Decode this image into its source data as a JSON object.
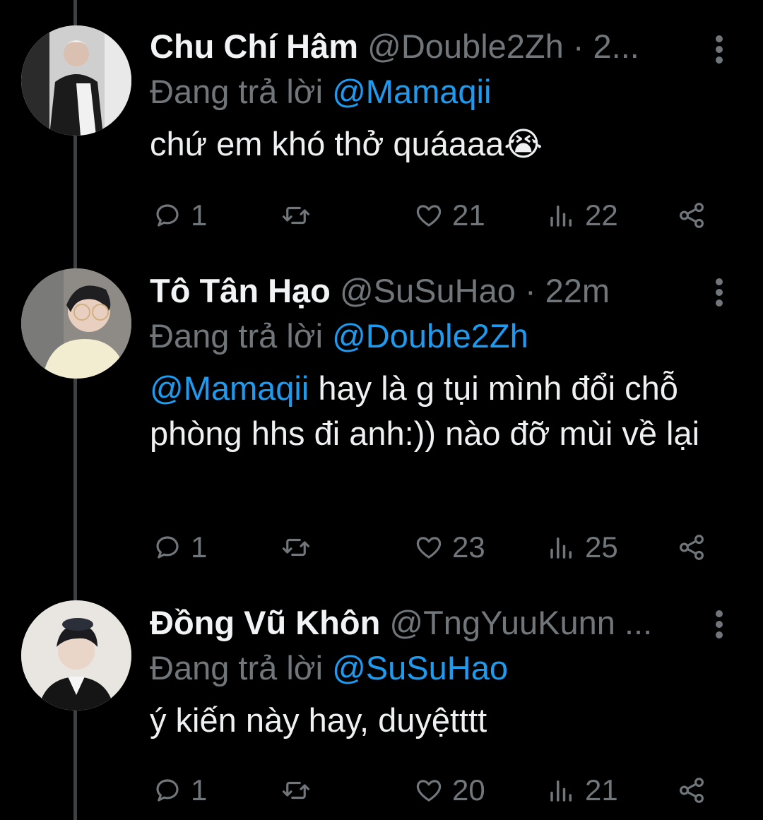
{
  "tweets": [
    {
      "name": "Chu Chí Hâm",
      "handle": "@Double2Zh",
      "time": "· 2...",
      "reply_prefix": "Đang trả lời",
      "reply_to": "@Mamaqii",
      "body_mention": "",
      "body": "chứ em khó thở quáaaa😭",
      "replies": "1",
      "retweets": "",
      "likes": "21",
      "views": "22"
    },
    {
      "name": "Tô Tân Hạo",
      "handle": "@SuSuHao",
      "time": "· 22m",
      "reply_prefix": "Đang trả lời",
      "reply_to": "@Double2Zh",
      "body_mention": "@Mamaqii",
      "body": " hay là g tụi mình đổi chỗ phòng hhs đi anh:)) nào đỡ mùi về lại",
      "replies": "1",
      "retweets": "",
      "likes": "23",
      "views": "25"
    },
    {
      "name": "Đồng Vũ Khôn",
      "handle": "@TngYuuKunn",
      "time": "...",
      "reply_prefix": "Đang trả lời",
      "reply_to": "@SuSuHao",
      "body_mention": "",
      "body": "ý kiến này hay, duyệtttt",
      "replies": "1",
      "retweets": "",
      "likes": "20",
      "views": "21"
    }
  ],
  "colors": {
    "background": "#000000",
    "text": "#e7e9ea",
    "secondary": "#71767b",
    "mention": "#1d9bf0",
    "thread_line": "#3e4144"
  },
  "icons": {
    "reply": "speech-bubble-icon",
    "retweet": "retweet-arrows-icon",
    "like": "heart-icon",
    "views": "bar-chart-icon",
    "share": "share-nodes-icon",
    "more": "vertical-ellipsis-icon"
  }
}
